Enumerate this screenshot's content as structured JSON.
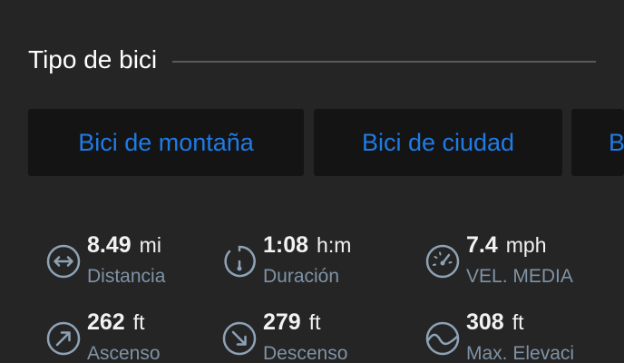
{
  "section": {
    "title": "Tipo de bici"
  },
  "bike_types": [
    {
      "label": "Bici de montaña",
      "selected": false
    },
    {
      "label": "Bici de ciudad",
      "selected": false
    },
    {
      "label": "B",
      "selected": false
    }
  ],
  "stats": [
    {
      "value": "8.49",
      "unit": "mi",
      "label": "Distancia",
      "icon": "distance-icon"
    },
    {
      "value": "1:08",
      "unit": "h:m",
      "label": "Duración",
      "icon": "stopwatch-icon"
    },
    {
      "value": "7.4",
      "unit": "mph",
      "label": "VEL. MEDIA",
      "icon": "speedometer-icon"
    },
    {
      "value": "262",
      "unit": "ft",
      "label": "Ascenso",
      "icon": "ascent-icon"
    },
    {
      "value": "279",
      "unit": "ft",
      "label": "Descenso",
      "icon": "descent-icon"
    },
    {
      "value": "308",
      "unit": "ft",
      "label": "Max. Elevaci",
      "icon": "elevation-icon"
    }
  ],
  "colors": {
    "background": "#252525",
    "chip_background": "#141414",
    "accent": "#1f7be6",
    "label": "#7f93a6",
    "icon": "#8ea2b5"
  }
}
